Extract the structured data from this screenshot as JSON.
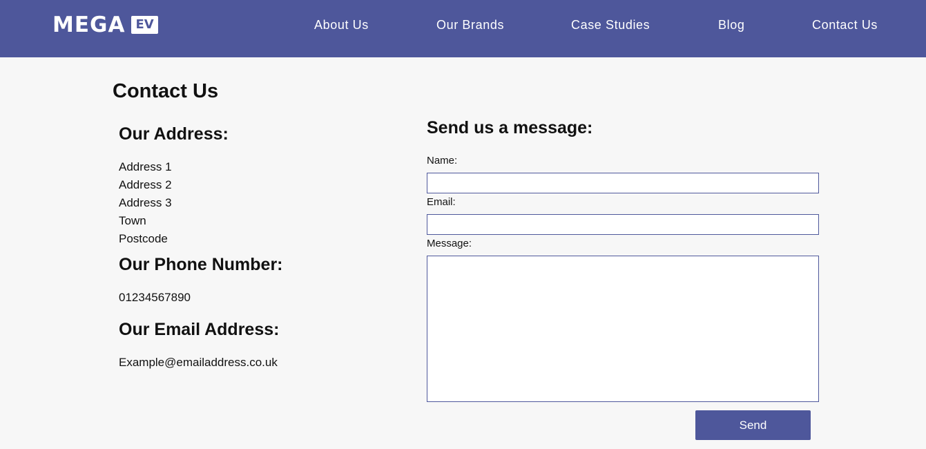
{
  "header": {
    "logo_text": "MEGA",
    "logo_badge": "EV",
    "nav": [
      {
        "label": "About Us"
      },
      {
        "label": "Our Brands"
      },
      {
        "label": "Case Studies"
      },
      {
        "label": "Blog"
      },
      {
        "label": "Contact Us"
      }
    ]
  },
  "page": {
    "title": "Contact Us"
  },
  "contact_info": {
    "address_heading": "Our Address:",
    "address_lines": [
      "Address 1",
      "Address 2",
      "Address 3",
      "Town",
      "Postcode"
    ],
    "phone_heading": "Our Phone Number:",
    "phone": "01234567890",
    "email_heading": "Our Email Address:",
    "email": "Example@emailaddress.co.uk"
  },
  "form": {
    "heading": "Send us a message:",
    "name_label": "Name:",
    "name_value": "",
    "email_label": "Email:",
    "email_value": "",
    "message_label": "Message:",
    "message_value": "",
    "send_label": "Send"
  },
  "colors": {
    "brand": "#4e579b",
    "background": "#f7f7f7",
    "text": "#111111"
  }
}
